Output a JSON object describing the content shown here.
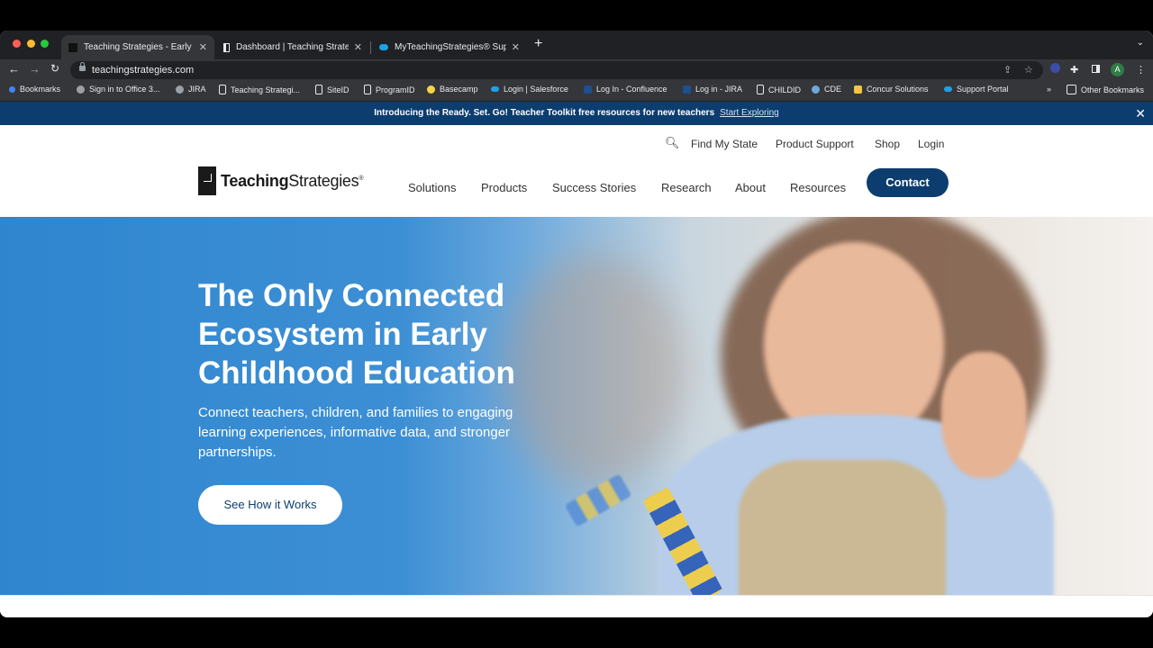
{
  "browser": {
    "tabs": [
      {
        "title": "Teaching Strategies - Early Ch"
      },
      {
        "title": "Dashboard | Teaching Strategi"
      },
      {
        "title": "MyTeachingStrategies® Suppo"
      }
    ],
    "url": "teachingstrategies.com",
    "avatar_letter": "A",
    "bookmarks": [
      {
        "label": "Bookmarks"
      },
      {
        "label": "Sign in to Office 3..."
      },
      {
        "label": "JIRA"
      },
      {
        "label": "Teaching Strategi..."
      },
      {
        "label": "SiteID"
      },
      {
        "label": "ProgramID"
      },
      {
        "label": "Basecamp"
      },
      {
        "label": "Login | Salesforce"
      },
      {
        "label": "Log In - Confluence"
      },
      {
        "label": "Log in - JIRA"
      },
      {
        "label": "CHILDID"
      },
      {
        "label": "CDE"
      },
      {
        "label": "Concur Solutions"
      },
      {
        "label": "Support Portal"
      }
    ],
    "bookmarks_overflow": "»",
    "other_bookmarks": "Other Bookmarks"
  },
  "announcement": {
    "text": "Introducing the Ready. Set. Go! Teacher Toolkit free resources for new teachers",
    "link": "Start Exploring"
  },
  "header": {
    "utility": [
      "Find My State",
      "Product Support",
      "Shop",
      "Login"
    ],
    "logo_bold": "Teaching",
    "logo_light": "Strategies",
    "logo_reg": "®",
    "nav": [
      "Solutions",
      "Products",
      "Success Stories",
      "Research",
      "About",
      "Resources"
    ],
    "contact": "Contact"
  },
  "hero": {
    "title": "The Only Connected Ecosystem in Early Childhood Education",
    "subtitle": "Connect teachers, children, and families to engaging learning experiences, informative data, and stronger partnerships.",
    "cta": "See How it Works"
  },
  "colors": {
    "brand_navy": "#0c3d6e",
    "hero_blue": "#2f86cf"
  }
}
